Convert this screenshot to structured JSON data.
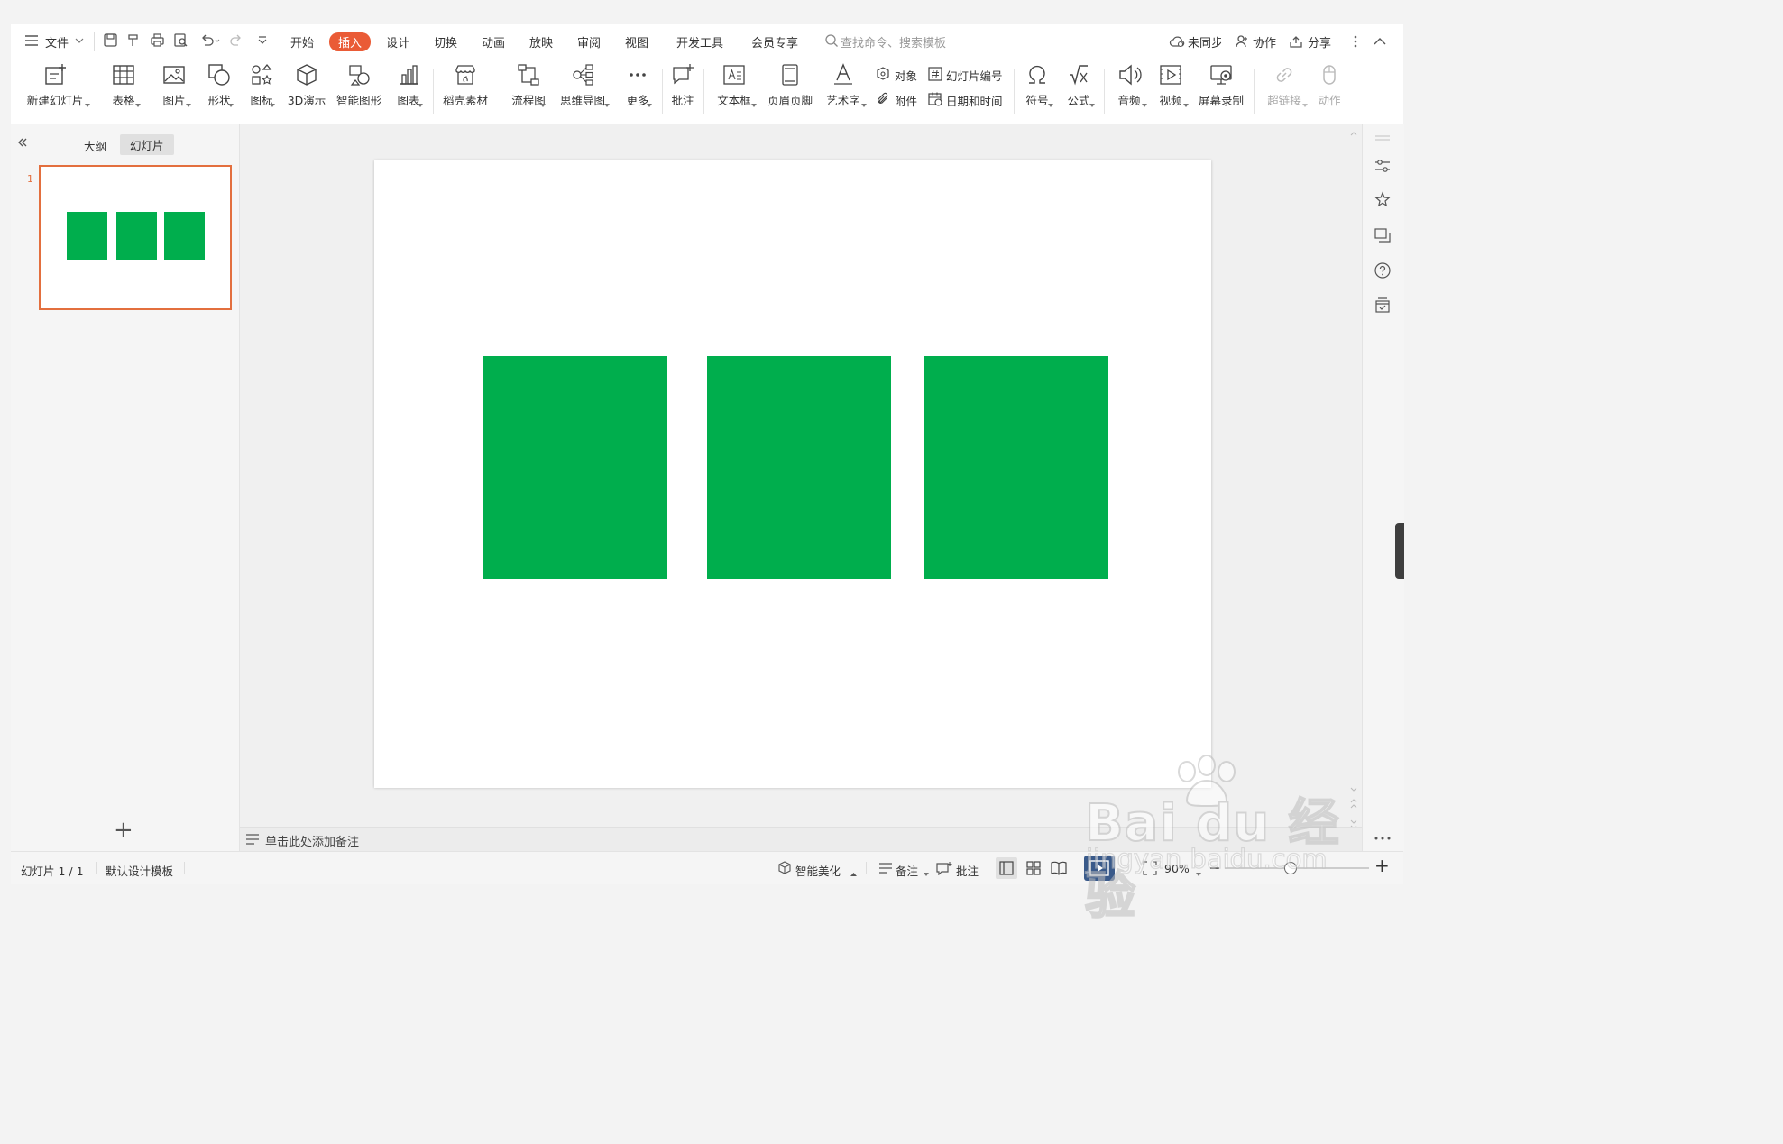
{
  "tabs": {
    "file": "文件",
    "items": [
      "开始",
      "插入",
      "设计",
      "切换",
      "动画",
      "放映",
      "审阅",
      "视图",
      "开发工具",
      "会员专享"
    ],
    "active_index": 1,
    "search_placeholder": "查找命令、搜索模板",
    "sync": "未同步",
    "collab": "协作",
    "share": "分享"
  },
  "ribbon": {
    "new_slide": "新建幻灯片",
    "table": "表格",
    "picture": "图片",
    "shape": "形状",
    "icon": "图标",
    "three_d": "3D演示",
    "smart_graphic": "智能图形",
    "chart": "图表",
    "daoke": "稻壳素材",
    "flowchart": "流程图",
    "mindmap": "思维导图",
    "more": "更多",
    "comment": "批注",
    "textbox": "文本框",
    "header_footer": "页眉页脚",
    "wordart": "艺术字",
    "object": "对象",
    "slide_number": "幻灯片编号",
    "attachment": "附件",
    "datetime": "日期和时间",
    "symbol": "符号",
    "formula": "公式",
    "audio": "音频",
    "video": "视频",
    "screen_record": "屏幕录制",
    "hyperlink": "超链接",
    "action": "动作"
  },
  "left_pane": {
    "tab_outline": "大纲",
    "tab_slides": "幻灯片",
    "slide_number": "1",
    "add_symbol": "+"
  },
  "notes_placeholder": "单击此处添加备注",
  "status": {
    "slide_info": "幻灯片 1 / 1",
    "template": "默认设计模板",
    "beautify": "智能美化",
    "notes": "备注",
    "comment": "批注",
    "zoom": "90%"
  },
  "watermark": {
    "brand": "Bai du 经验",
    "url": "jingyan.baidu.com"
  },
  "colors": {
    "accent": "#ea5b36",
    "shape_fill": "#00ae4d",
    "thumb_border": "#e36f3e"
  }
}
